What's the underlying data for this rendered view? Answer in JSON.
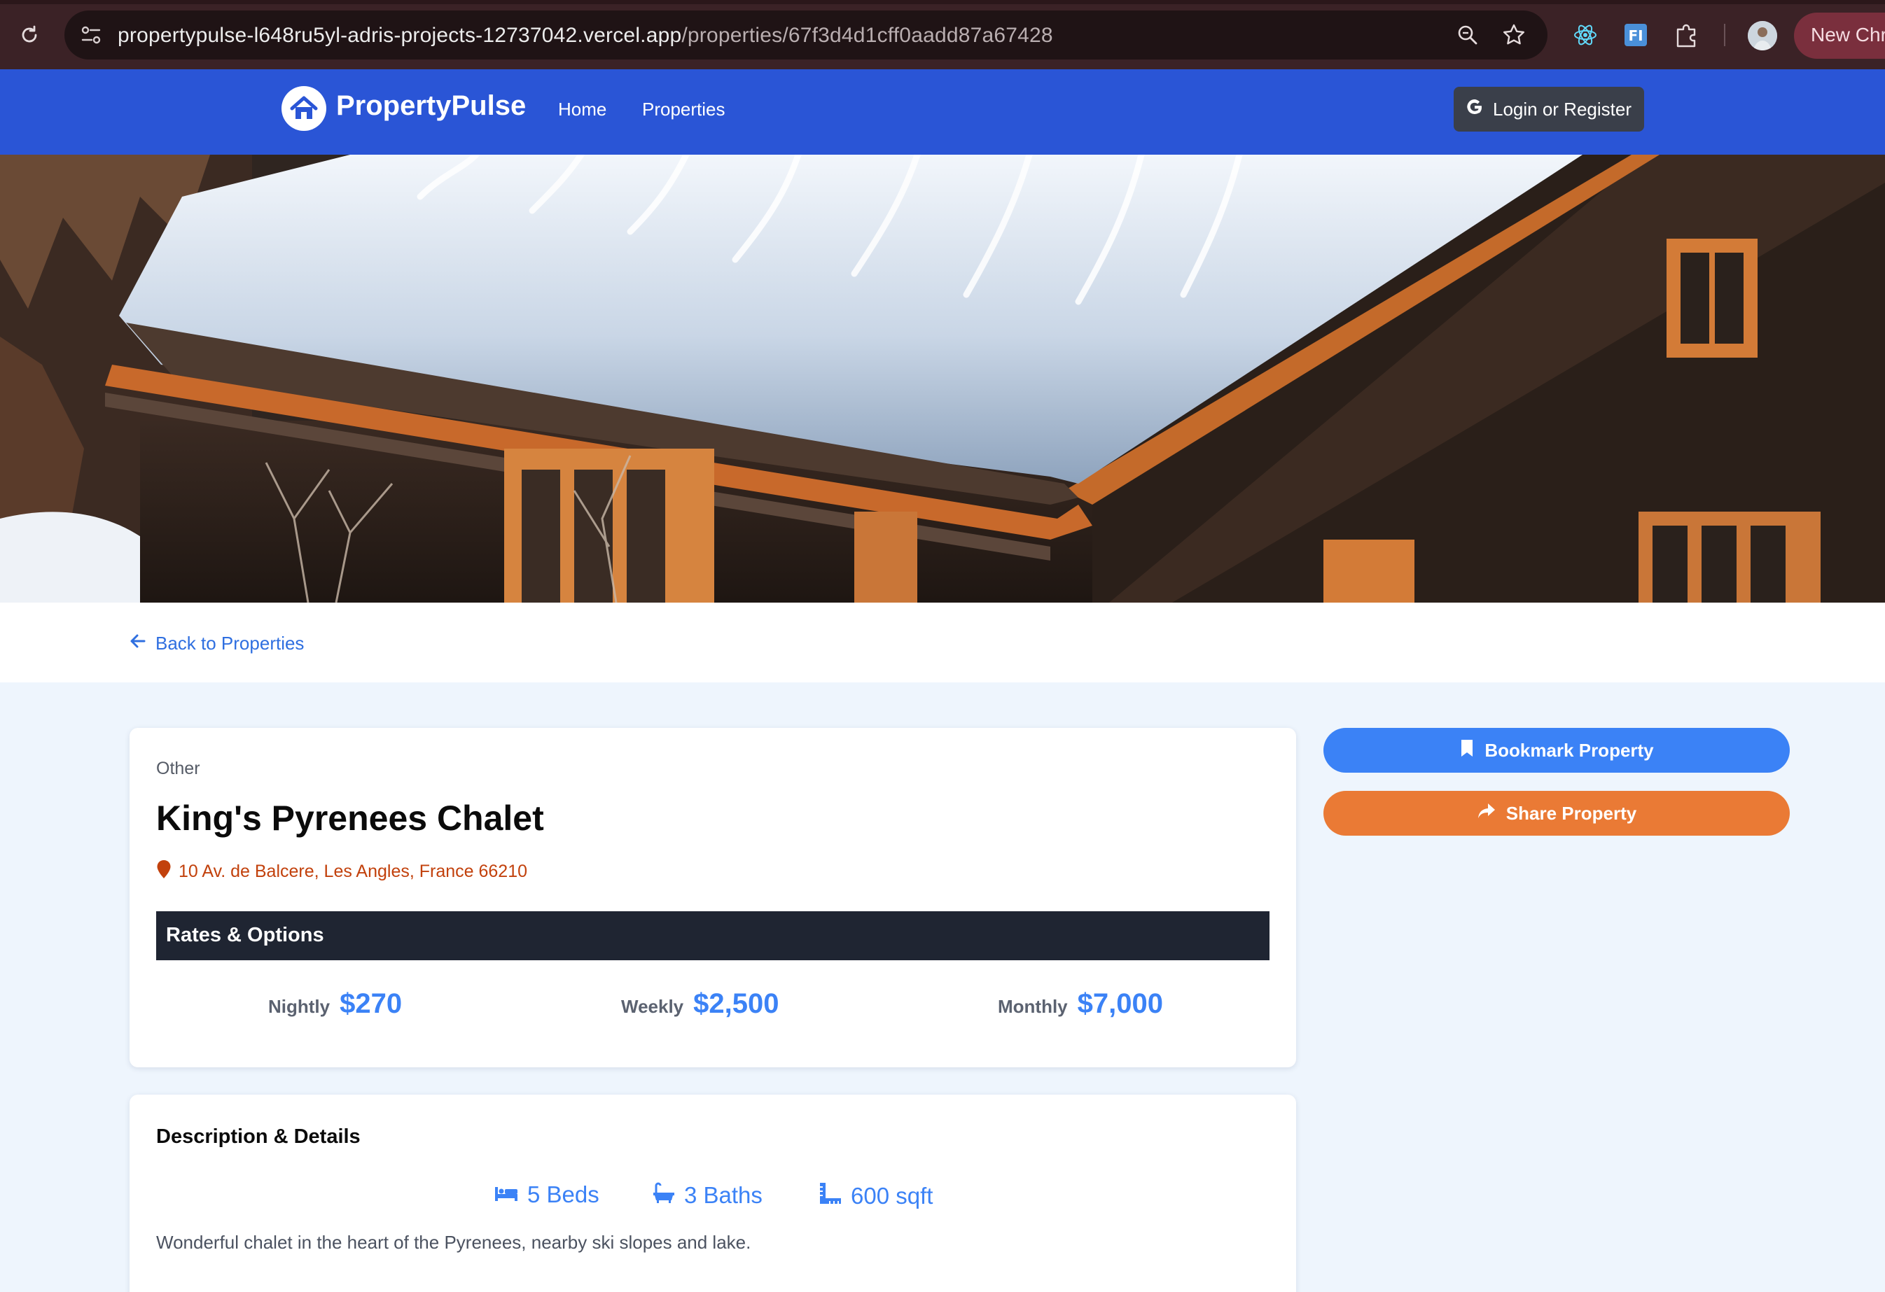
{
  "browser": {
    "url_host": "propertypulse-l648ru5yl-adris-projects-12737042.vercel.app",
    "url_path": "/properties/67f3d4d1cff0aadd87a67428",
    "new_chrome_label": "New Chro",
    "icons": [
      "reload-icon",
      "site-info-icon",
      "zoom-icon",
      "star-icon",
      "react-devtools-icon",
      "fi-extension-icon",
      "extensions-puzzle-icon",
      "profile-avatar"
    ]
  },
  "navbar": {
    "brand": "PropertyPulse",
    "links": [
      {
        "label": "Home"
      },
      {
        "label": "Properties"
      }
    ],
    "login_label": "Login or Register",
    "color": "#2a55d6"
  },
  "back_link": "Back to Properties",
  "property": {
    "type": "Other",
    "name": "King's Pyrenees Chalet",
    "address": "10 Av. de Balcere, Les Angles, France 66210",
    "rates_title": "Rates & Options",
    "rates": [
      {
        "label": "Nightly",
        "value": "$270"
      },
      {
        "label": "Weekly",
        "value": "$2,500"
      },
      {
        "label": "Monthly",
        "value": "$7,000"
      }
    ]
  },
  "details": {
    "title": "Description & Details",
    "beds": "5 Beds",
    "baths": "3 Baths",
    "sqft": "600 sqft",
    "description": "Wonderful chalet in the heart of the Pyrenees, nearby ski slopes and lake."
  },
  "sidebar": {
    "bookmark_label": "Bookmark Property",
    "share_label": "Share Property",
    "bookmark_color": "#3b82f6",
    "share_color": "#ea7a35"
  }
}
